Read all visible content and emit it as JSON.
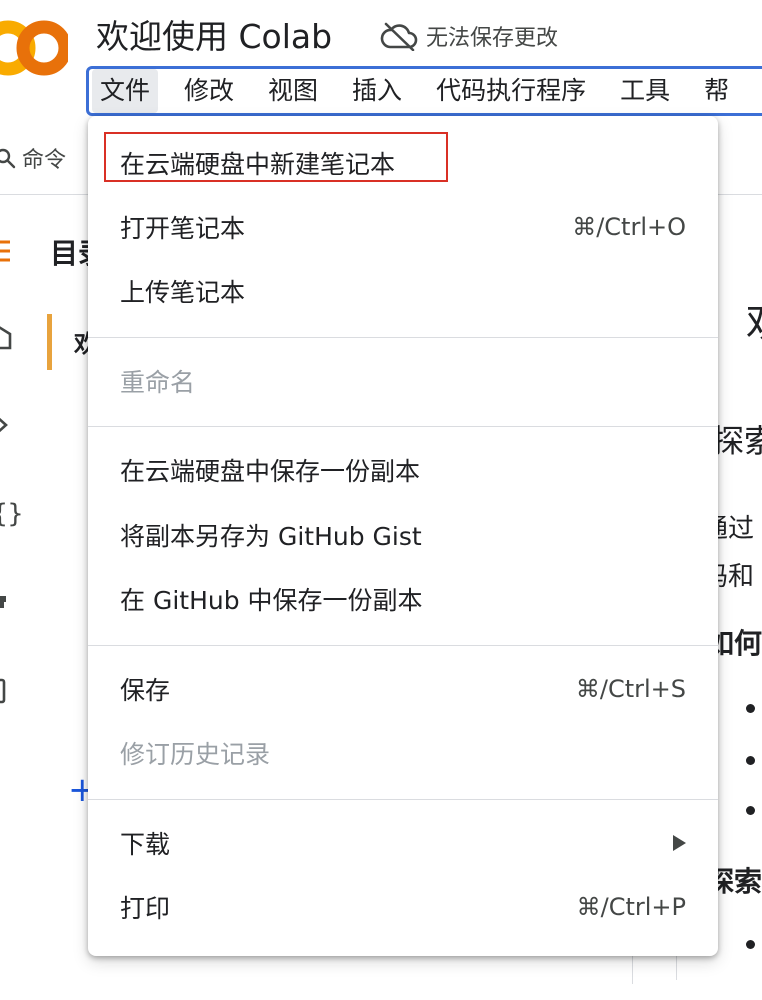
{
  "header": {
    "doc_title": "欢迎使用 Colab",
    "save_status": "无法保存更改",
    "save_status_icon": "cloud-off-icon"
  },
  "menubar": {
    "items": [
      "文件",
      "修改",
      "视图",
      "插入",
      "代码执行程序",
      "工具",
      "帮"
    ]
  },
  "toolbar": {
    "command_label": "命令"
  },
  "sidebar": {
    "toc_title": "目录",
    "toc_item": "欢",
    "add_label": "+"
  },
  "notebook": {
    "h1": "欢",
    "h2": "探索",
    "p1": "通过",
    "p2": "码和",
    "bold1": "如何",
    "bold2": "探索"
  },
  "file_menu": {
    "items": [
      {
        "label": "在云端硬盘中新建笔记本",
        "shortcut": ""
      },
      {
        "label": "打开笔记本",
        "shortcut": "⌘/Ctrl+O"
      },
      {
        "label": "上传笔记本",
        "shortcut": ""
      },
      {
        "label": "重命名",
        "shortcut": ""
      },
      {
        "label": "在云端硬盘中保存一份副本",
        "shortcut": ""
      },
      {
        "label": "将副本另存为 GitHub Gist",
        "shortcut": ""
      },
      {
        "label": "在 GitHub 中保存一份副本",
        "shortcut": ""
      },
      {
        "label": "保存",
        "shortcut": "⌘/Ctrl+S"
      },
      {
        "label": "修订历史记录",
        "shortcut": ""
      },
      {
        "label": "下载",
        "shortcut": ""
      },
      {
        "label": "打印",
        "shortcut": "⌘/Ctrl+P"
      }
    ]
  },
  "colors": {
    "accent_blue": "#3c6fd6",
    "highlight_red": "#d93025",
    "logo_orange": "#f9ab00",
    "logo_dark_orange": "#e8710a",
    "disabled_text": "#9aa0a6"
  }
}
